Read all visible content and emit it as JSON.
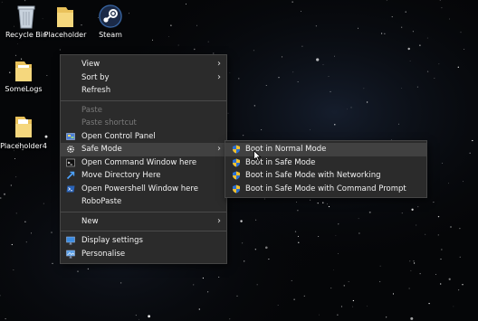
{
  "desktop_icons": [
    {
      "name": "recycle-bin",
      "label": "Recycle Bin"
    },
    {
      "name": "placeholder",
      "label": "Placeholder"
    },
    {
      "name": "steam",
      "label": "Steam"
    },
    {
      "name": "somelogs",
      "label": "SomeLogs"
    },
    {
      "name": "placeholder4",
      "label": "Placeholder4"
    }
  ],
  "context_menu": {
    "view": "View",
    "sort_by": "Sort by",
    "refresh": "Refresh",
    "paste": "Paste",
    "paste_shortcut": "Paste shortcut",
    "open_control_panel": "Open Control Panel",
    "safe_mode": "Safe Mode",
    "open_command_window": "Open Command Window here",
    "move_directory": "Move Directory Here",
    "open_powershell": "Open Powershell Window here",
    "robopaste": "RoboPaste",
    "new": "New",
    "display_settings": "Display settings",
    "personalise": "Personalise"
  },
  "safe_mode_submenu": [
    "Boot in Normal Mode",
    "Boot in Safe Mode",
    "Boot in Safe Mode with Networking",
    "Boot in Safe Mode with Command Prompt"
  ],
  "colors": {
    "menu_bg": "#2b2b2b",
    "highlight": "#414141",
    "disabled_text": "#7a7a7a"
  }
}
